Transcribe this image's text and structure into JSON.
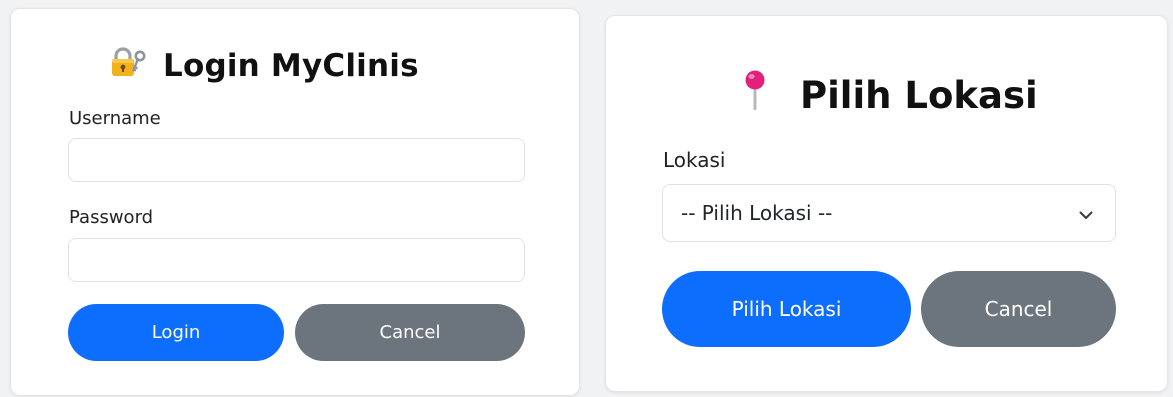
{
  "login": {
    "title": "Login MyClinis",
    "title_icon": "lock-with-key-icon",
    "username_label": "Username",
    "username_value": "",
    "password_label": "Password",
    "password_value": "",
    "login_label": "Login",
    "cancel_label": "Cancel"
  },
  "lokasi": {
    "title": "Pilih Lokasi",
    "title_icon": "round-pushpin-icon",
    "label": "Lokasi",
    "select_value": "-- Pilih Lokasi --",
    "submit_label": "Pilih Lokasi",
    "cancel_label": "Cancel"
  },
  "colors": {
    "primary": "#0d6efd",
    "secondary": "#6c757d",
    "pin": "#e4217a"
  }
}
